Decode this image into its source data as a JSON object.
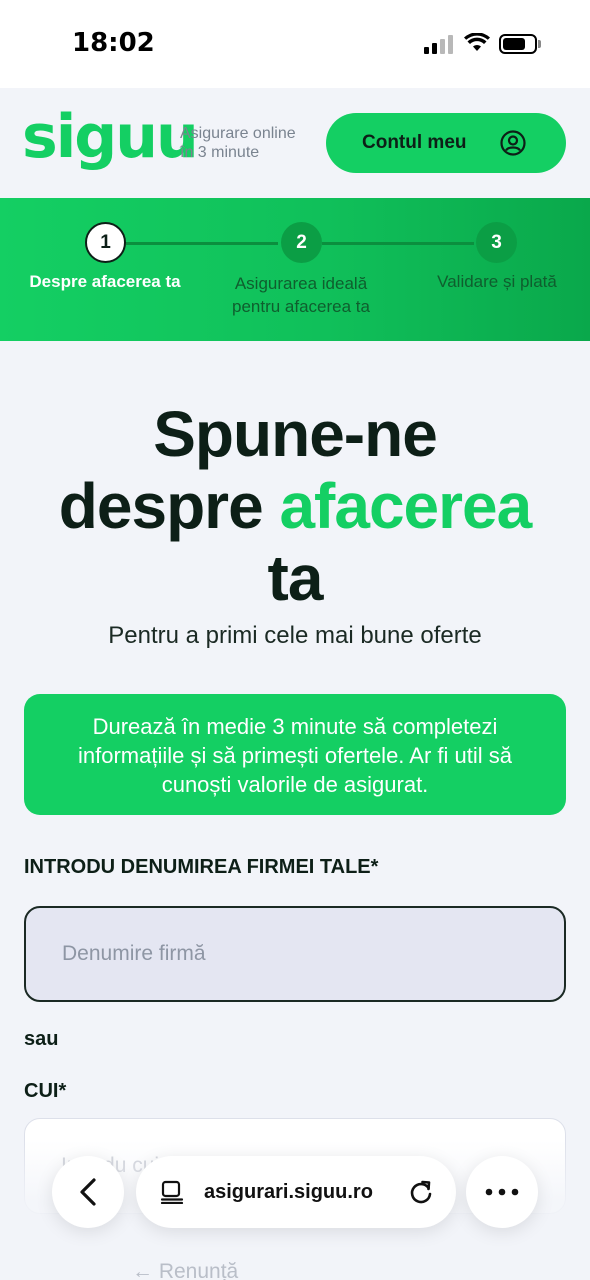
{
  "status_bar": {
    "time": "18:02"
  },
  "header": {
    "logo": "siguu",
    "tagline_line1": "Asigurare online",
    "tagline_line2": "în 3 minute",
    "account_button": "Contul meu",
    "account_icon": "user-circle-icon"
  },
  "stepper": {
    "steps": [
      {
        "number": "1",
        "label_line1": "Despre afacerea ta",
        "label_line2": "",
        "active": true
      },
      {
        "number": "2",
        "label_line1": "Asigurarea ideală",
        "label_line2": "pentru afacerea ta",
        "active": false
      },
      {
        "number": "3",
        "label_line1": "Validare și plată",
        "label_line2": "",
        "active": false
      }
    ]
  },
  "hero": {
    "title_line1": "Spune-ne",
    "title_word": "despre",
    "title_accent": "afacerea",
    "title_line3": "ta",
    "subtitle": "Pentru a primi cele mai bune oferte"
  },
  "info_card": {
    "text": "Durează în medie 3 minute să completezi informațiile și să primești ofertele. Ar fi util să cunoști valorile de asigurat."
  },
  "form": {
    "company_label": "INTRODU DENUMIREA FIRMEI TALE*",
    "company_placeholder": "Denumire firmă",
    "company_value": "",
    "or_text": "sau",
    "cui_label": "CUI*",
    "cui_placeholder": "Introdu cui",
    "cui_value": "",
    "cancel_link": "← Renunță"
  },
  "browser": {
    "url": "asigurari.siguu.ro",
    "back_icon": "chevron-left-icon",
    "reader_icon": "reader-mode-icon",
    "reload_icon": "reload-icon",
    "more_icon": "more-dots-icon"
  },
  "colors": {
    "brand_green": "#14cf63",
    "dark_text": "#0d1f17",
    "page_bg": "#f2f4f9"
  }
}
